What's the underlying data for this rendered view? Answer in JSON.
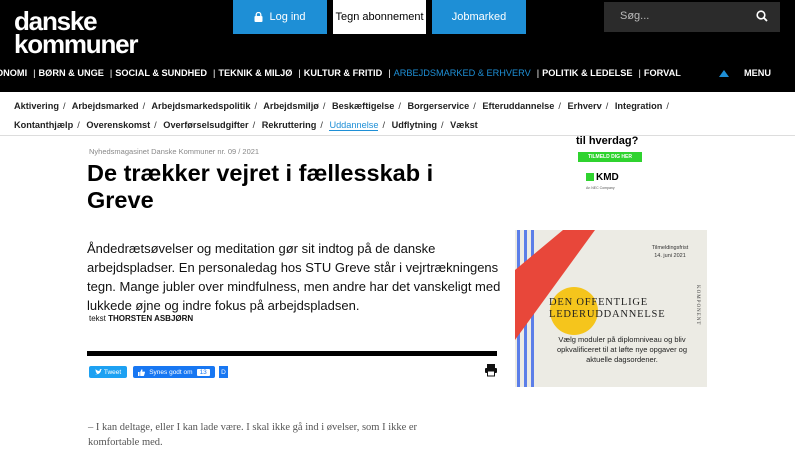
{
  "header": {
    "logo_line1": "danske",
    "logo_line2": "kommuner",
    "login_label": "Log ind",
    "subscribe_label": "Tegn abonnement",
    "jobs_label": "Jobmarked",
    "search_placeholder": "Søg..."
  },
  "main_nav": {
    "items": [
      "ONOMI",
      "BØRN & UNGE",
      "SOCIAL & SUNDHED",
      "TEKNIK & MILJØ",
      "KULTUR & FRITID",
      "ARBEJDSMARKED & ERHVERV",
      "POLITIK & LEDELSE",
      "FORVAL"
    ],
    "active_index": 5,
    "menu_label": "MENU"
  },
  "tags": {
    "items": [
      "Aktivering",
      "Arbejdsmarked",
      "Arbejdsmarkedspolitik",
      "Arbejdsmiljø",
      "Beskæftigelse",
      "Borgerservice",
      "Efteruddannelse",
      "Erhverv",
      "Integration",
      "Kontanthjælp",
      "Overenskomst",
      "Overførselsudgifter",
      "Rekruttering",
      "Uddannelse",
      "Udflytning",
      "Vækst"
    ],
    "active": "Uddannelse"
  },
  "article": {
    "kicker": "Nyhedsmagasinet Danske Kommuner nr. 09 / 2021",
    "headline": "De trækker vejret i fællesskab i Greve",
    "lead": "Åndedrætsøvelser og meditation gør sit indtog på de danske arbejdspladser. En personaledag hos STU Greve står i vejrtrækningens tegn. Mange jubler over mindfulness, men andre har det vanskeligt med lukkede øjne og indre fokus på arbejdspladsen.",
    "byline_prefix": "tekst",
    "author": "THORSTEN ASBJØRN",
    "quote_line1": "– I kan deltage, eller I kan lade være. I skal ikke gå ind i øvelser, som I ikke er",
    "quote_line2": "komfortable med."
  },
  "share": {
    "tweet_label": "Tweet",
    "like_label": "Synes godt om",
    "like_count": "13",
    "extra_label": "D"
  },
  "ad_kmd": {
    "title": "til hverdag?",
    "button": "TILMELD DIG HER",
    "logo": "KMD",
    "sub": "An NEC Company"
  },
  "ad_komponent": {
    "date_line1": "Tilmeldingsfrist",
    "date_line2": "14. juni 2021",
    "title_line1": "DEN OFFENTLIGE",
    "title_line2": "LEDERUDDANNELSE",
    "side_text": "KOMPONENT",
    "body": "Vælg moduler på diplomniveau og bliv opkvalificeret til at løfte nye opgaver og aktuelle dagsordener."
  },
  "colors": {
    "accent": "#1e8fd6",
    "topbar": "#000000",
    "kmd_green": "#2fd32f",
    "ad_red": "#e8473a",
    "ad_blue": "#5b7ee8",
    "ad_yellow": "#f5c51c"
  },
  "icons": [
    "lock-icon",
    "search-icon",
    "arrow-up-icon",
    "print-icon",
    "twitter-icon",
    "facebook-like-icon"
  ]
}
